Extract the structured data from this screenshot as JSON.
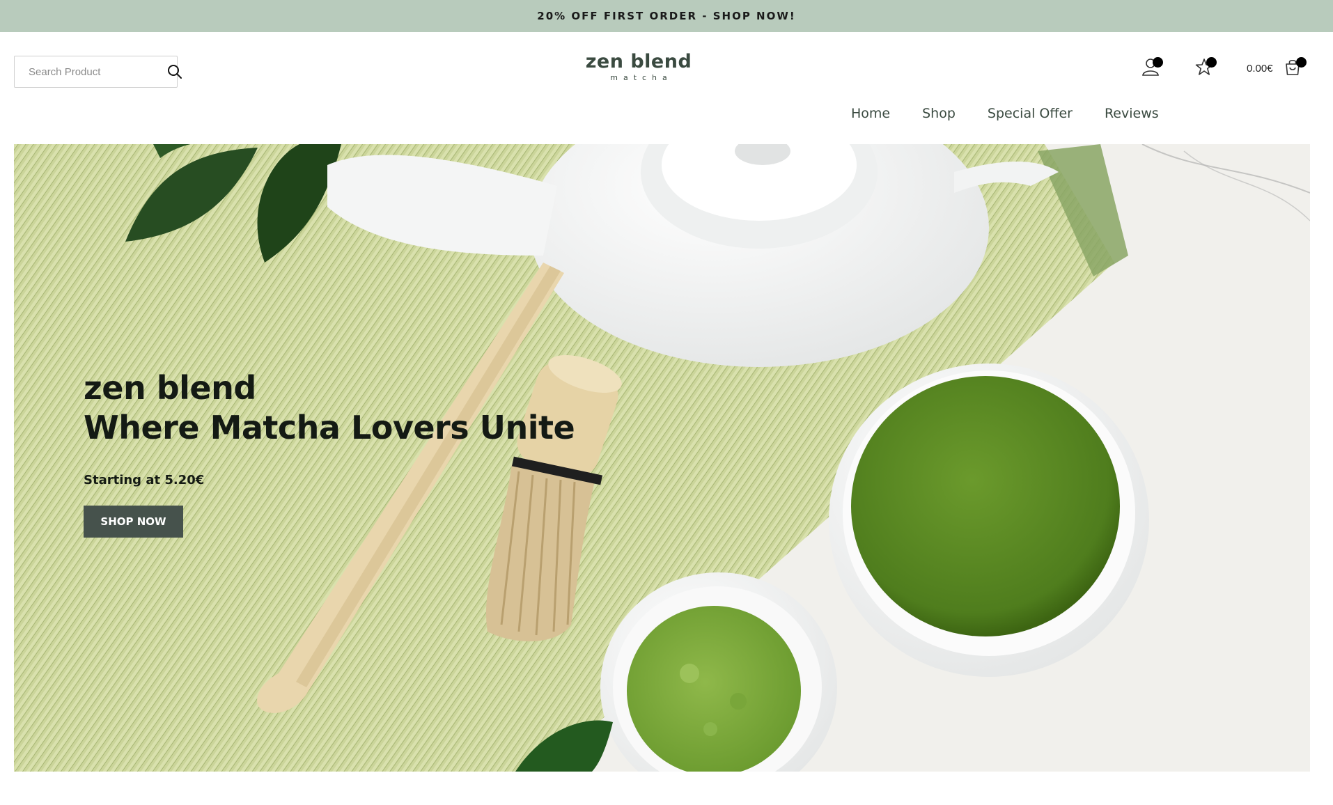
{
  "announcement": {
    "text": "20% OFF FIRST ORDER - SHOP NOW!"
  },
  "search": {
    "placeholder": "Search Product",
    "icon": "search-icon"
  },
  "logo": {
    "brand": "zen blend",
    "tagline": "matcha"
  },
  "header": {
    "account_icon": "user-icon",
    "wishlist_icon": "star-icon",
    "cart_icon": "shopping-bag-icon",
    "cart_total": "0.00€"
  },
  "nav": {
    "items": [
      {
        "label": "Home"
      },
      {
        "label": "Shop"
      },
      {
        "label": "Special Offer"
      },
      {
        "label": "Reviews"
      }
    ]
  },
  "hero": {
    "title_line1": "zen blend",
    "title_line2": "Where Matcha Lovers Unite",
    "price_text": "Starting at 5.20€",
    "button_label": "SHOP NOW"
  },
  "colors": {
    "announcement_bg": "#b8cbbc",
    "button_bg": "#46524c",
    "brand_text": "#3a4a40"
  }
}
